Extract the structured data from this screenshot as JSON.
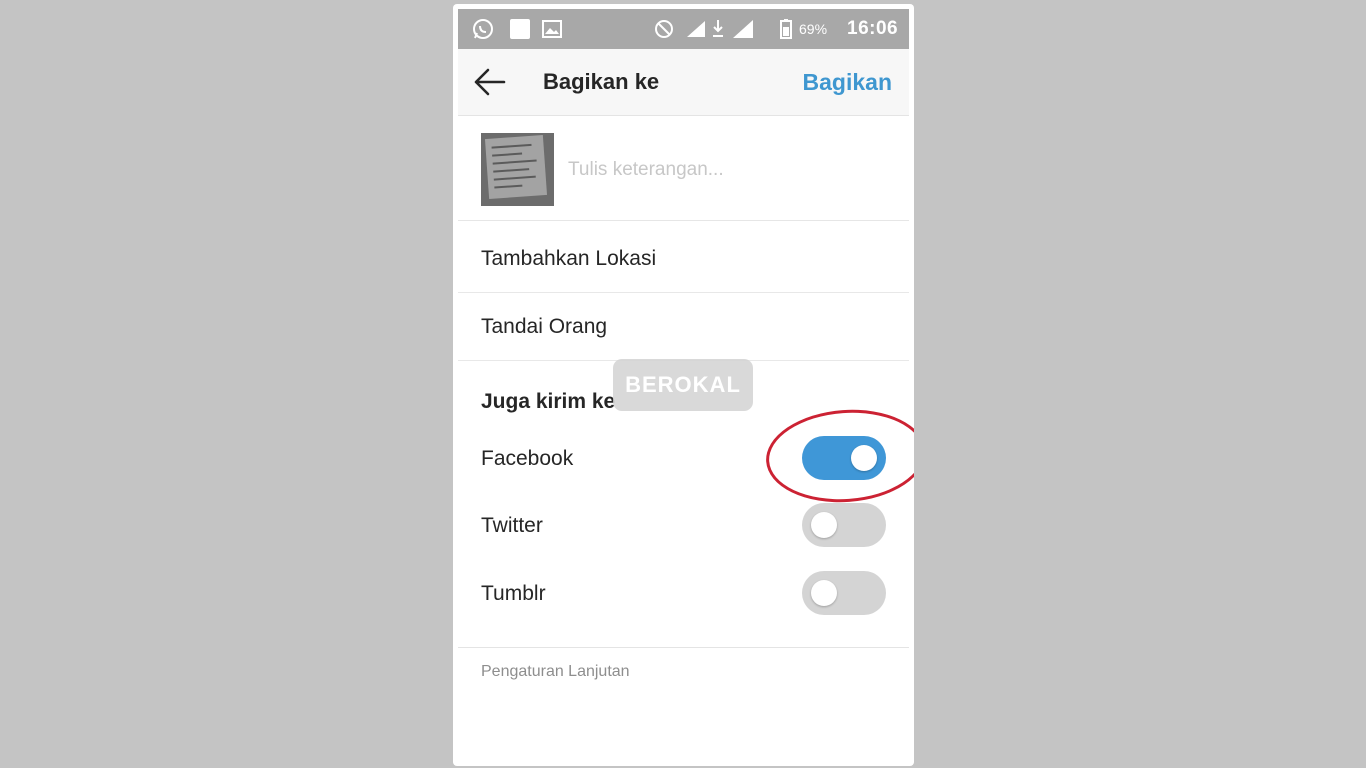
{
  "status_bar": {
    "battery": "69%",
    "time": "16:06",
    "icons": [
      "whatsapp-icon",
      "notification-icon",
      "image-icon",
      "do-not-disturb-icon",
      "signal-icon",
      "download-icon",
      "signal-icon",
      "battery-icon"
    ]
  },
  "app_bar": {
    "back_icon": "arrow-left-icon",
    "title": "Bagikan ke",
    "share_label": "Bagikan"
  },
  "caption": {
    "placeholder": "Tulis keterangan...",
    "value": ""
  },
  "rows": {
    "location": "Tambahkan Lokasi",
    "tag_people": "Tandai Orang"
  },
  "share_section": {
    "title": "Juga kirim ke",
    "options": [
      {
        "label": "Facebook",
        "enabled": true
      },
      {
        "label": "Twitter",
        "enabled": false
      },
      {
        "label": "Tumblr",
        "enabled": false
      }
    ]
  },
  "advanced_settings": "Pengaturan Lanjutan",
  "watermark": "BEROKAL",
  "colors": {
    "accent": "#3f97d7",
    "status_bar": "#a8a8a8",
    "highlight": "#cc2233"
  }
}
